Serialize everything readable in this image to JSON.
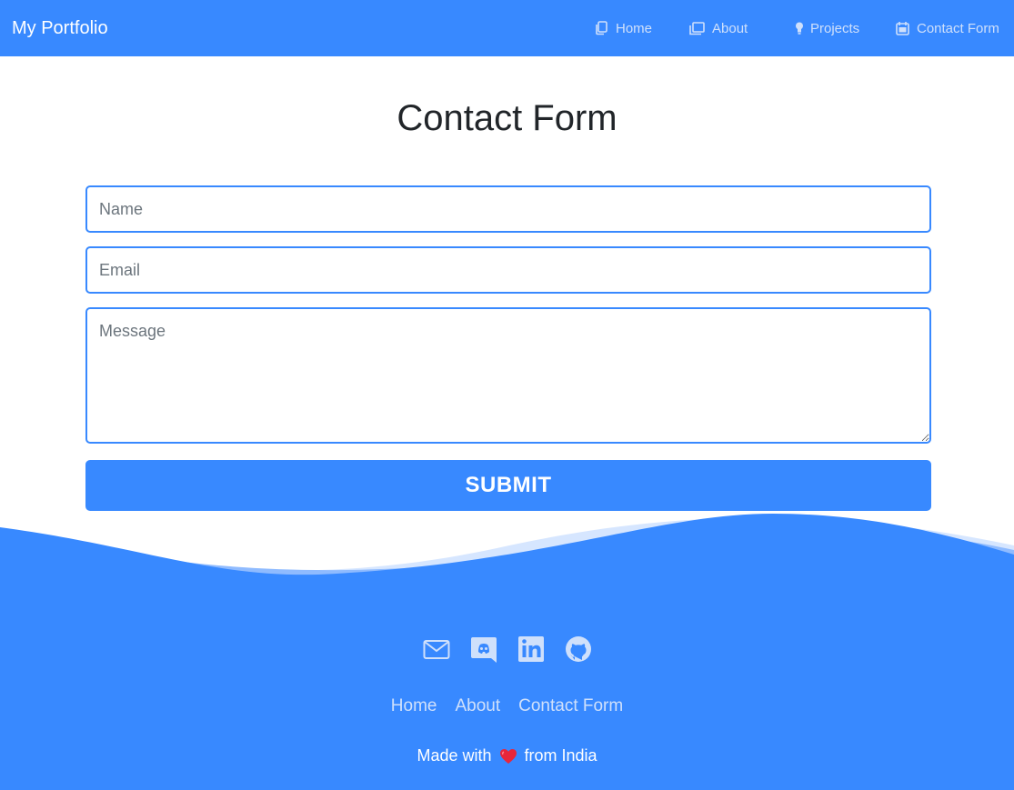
{
  "navbar": {
    "brand": "My Portfolio",
    "items": [
      {
        "label": "Home",
        "icon": "copy-icon"
      },
      {
        "label": "About",
        "icon": "pages-icon"
      },
      {
        "label": "Projects",
        "icon": "lightbulb-icon"
      },
      {
        "label": "Contact Form",
        "icon": "calendar-icon"
      }
    ]
  },
  "main": {
    "title": "Contact Form",
    "name_placeholder": "Name",
    "email_placeholder": "Email",
    "message_placeholder": "Message",
    "submit_label": "SUBMIT"
  },
  "footer": {
    "social": [
      "mail-icon",
      "discord-icon",
      "linkedin-icon",
      "github-icon"
    ],
    "links": [
      "Home",
      "About",
      "Contact Form"
    ],
    "made_prefix": "Made with",
    "made_suffix": "from India"
  },
  "colors": {
    "primary": "#3889ff",
    "nav_text": "#cfe0fb",
    "title_text": "#212529"
  }
}
